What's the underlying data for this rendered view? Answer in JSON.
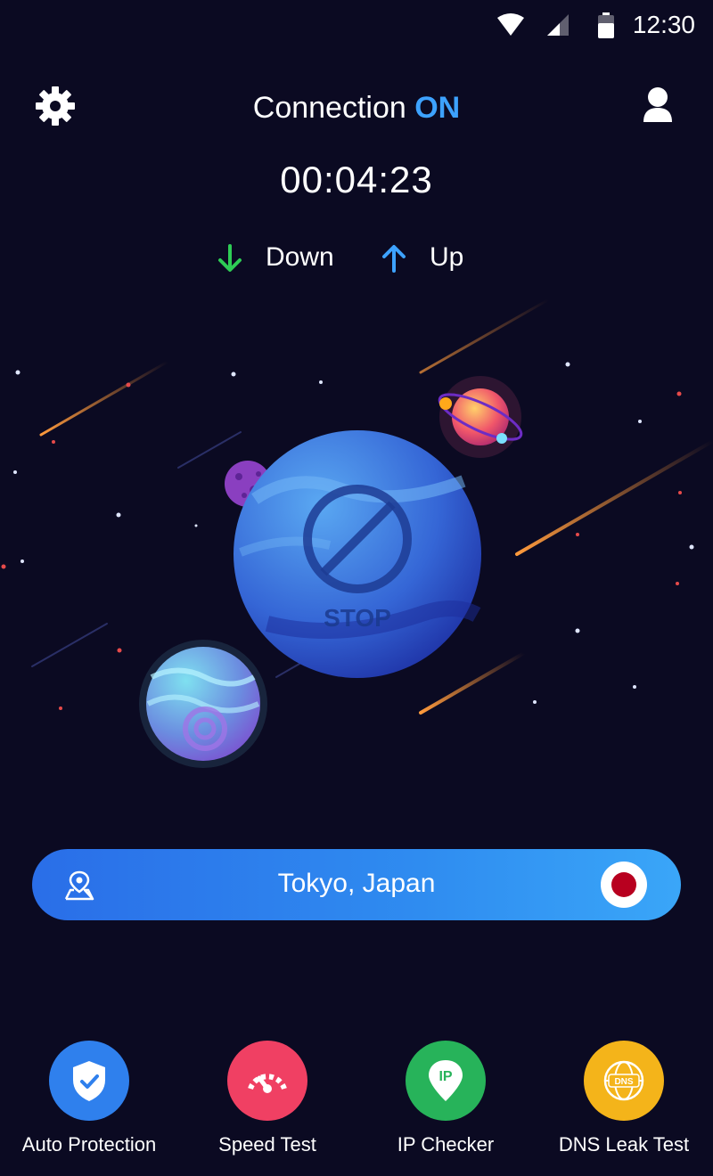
{
  "status_bar": {
    "time": "12:30"
  },
  "header": {
    "title_prefix": "Connection",
    "title_status": "ON",
    "timer": "00:04:23"
  },
  "speed": {
    "down_label": "Down",
    "up_label": "Up"
  },
  "stop_button": {
    "label": "STOP"
  },
  "location": {
    "name": "Tokyo, Japan"
  },
  "tools": [
    {
      "label": "Auto Protection",
      "color": "#2f80ed"
    },
    {
      "label": "Speed Test",
      "color": "#f04063"
    },
    {
      "label": "IP Checker",
      "color": "#27b35a"
    },
    {
      "label": "DNS Leak Test",
      "color": "#f4b41a"
    }
  ],
  "colors": {
    "background": "#0b0a22",
    "accent": "#3da2ff",
    "down_arrow": "#2ecc55",
    "up_arrow": "#3da2ff"
  }
}
